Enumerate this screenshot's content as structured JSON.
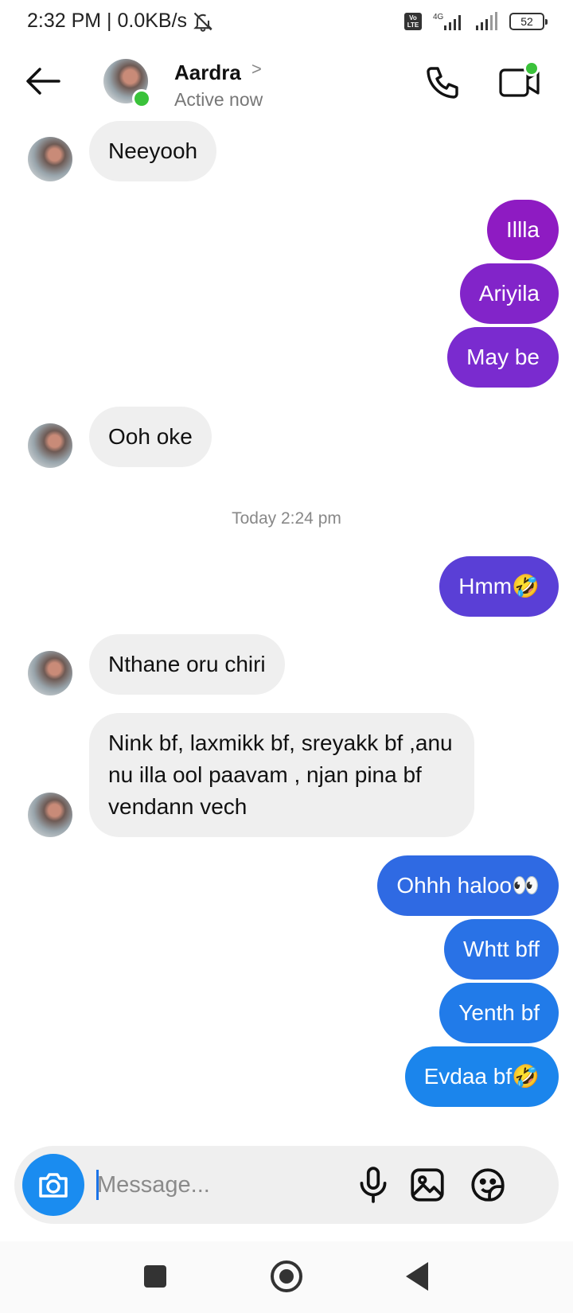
{
  "status_bar": {
    "time_speed": "2:32 PM | 0.0KB/s",
    "network": "4G",
    "volte": "Vo LTE",
    "battery": "52"
  },
  "header": {
    "contact_name": "Aardra",
    "chevron": ">",
    "contact_status": "Active now"
  },
  "messages": [
    {
      "direction": "incoming",
      "text": "Neeyooh"
    },
    {
      "direction": "outgoing",
      "text": "Illla",
      "color": "#8e1bc2"
    },
    {
      "direction": "outgoing",
      "text": "Ariyila",
      "color": "#8224c9"
    },
    {
      "direction": "outgoing",
      "text": "May be",
      "color": "#7a2bcf"
    },
    {
      "direction": "incoming",
      "text": "Ooh oke"
    },
    {
      "direction": "outgoing",
      "text": "Hmm🤣",
      "color": "#5a3fd6"
    },
    {
      "direction": "incoming",
      "text": "Nthane oru chiri"
    },
    {
      "direction": "incoming",
      "text": "Nink bf, laxmikk bf, sreyakk bf ,anu nu illa ool paavam , njan pina bf vendann vech"
    },
    {
      "direction": "outgoing",
      "text": "Ohhh haloo👀",
      "color": "#2f6ae3"
    },
    {
      "direction": "outgoing",
      "text": "Whtt bff",
      "color": "#2972e6"
    },
    {
      "direction": "outgoing",
      "text": "Yenth bf",
      "color": "#217be9"
    },
    {
      "direction": "outgoing",
      "text": "Evdaa bf🤣",
      "color": "#1b85ec"
    }
  ],
  "timestamp": "Today 2:24 pm",
  "composer": {
    "placeholder": "Message..."
  },
  "icons": [
    "back-arrow-icon",
    "phone-icon",
    "video-call-icon",
    "camera-icon",
    "microphone-icon",
    "gallery-icon",
    "sticker-icon",
    "bell-off-icon"
  ],
  "colors": {
    "incoming_bubble": "#efefef",
    "online": "#3ac23a",
    "camera_button": "#1a8cf0"
  }
}
